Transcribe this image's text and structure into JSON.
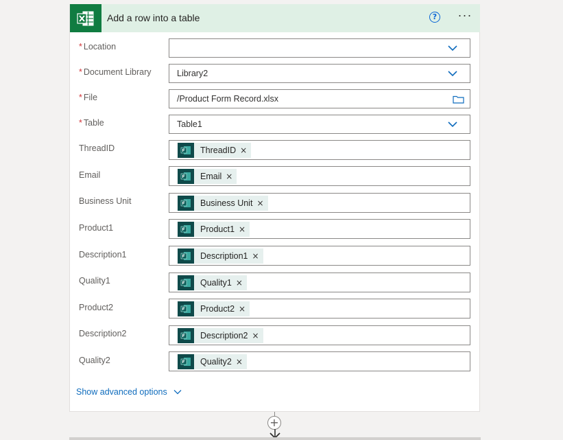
{
  "action": {
    "title": "Add a row into a table",
    "help_icon_glyph": "?",
    "more_glyph": "···"
  },
  "fields": {
    "location": {
      "label": "Location",
      "required_mark": "*",
      "value": ""
    },
    "document_library": {
      "label": "Document Library",
      "required_mark": "*",
      "value": "Library2"
    },
    "file": {
      "label": "File",
      "required_mark": "*",
      "value": "/Product Form Record.xlsx"
    },
    "table": {
      "label": "Table",
      "required_mark": "*",
      "value": "Table1"
    }
  },
  "columns": [
    {
      "label": "ThreadID",
      "token": "ThreadID"
    },
    {
      "label": "Email",
      "token": "Email"
    },
    {
      "label": "Business Unit",
      "token": "Business Unit"
    },
    {
      "label": "Product1",
      "token": "Product1"
    },
    {
      "label": "Description1",
      "token": "Description1"
    },
    {
      "label": "Quality1",
      "token": "Quality1"
    },
    {
      "label": "Product2",
      "token": "Product2"
    },
    {
      "label": "Description2",
      "token": "Description2"
    },
    {
      "label": "Quality2",
      "token": "Quality2"
    }
  ],
  "token_remove_glyph": "×",
  "advanced_options": "Show advanced options",
  "add_step_glyph": "+",
  "colors": {
    "header_bg": "#dff0e5",
    "excel_green": "#107c41",
    "token_icon_bg": "#0f4a4a",
    "token_bg": "#e6f0ee",
    "link_blue": "#0f6cbd",
    "required_red": "#d13438"
  },
  "icons": {
    "header": "excel-icon",
    "help": "help-icon",
    "more": "more-icon",
    "dropdown": "chevron-down-icon",
    "file_picker": "folder-icon",
    "token": "forms-icon",
    "remove": "close-icon",
    "add": "plus-icon",
    "arrow": "arrow-down-icon"
  }
}
